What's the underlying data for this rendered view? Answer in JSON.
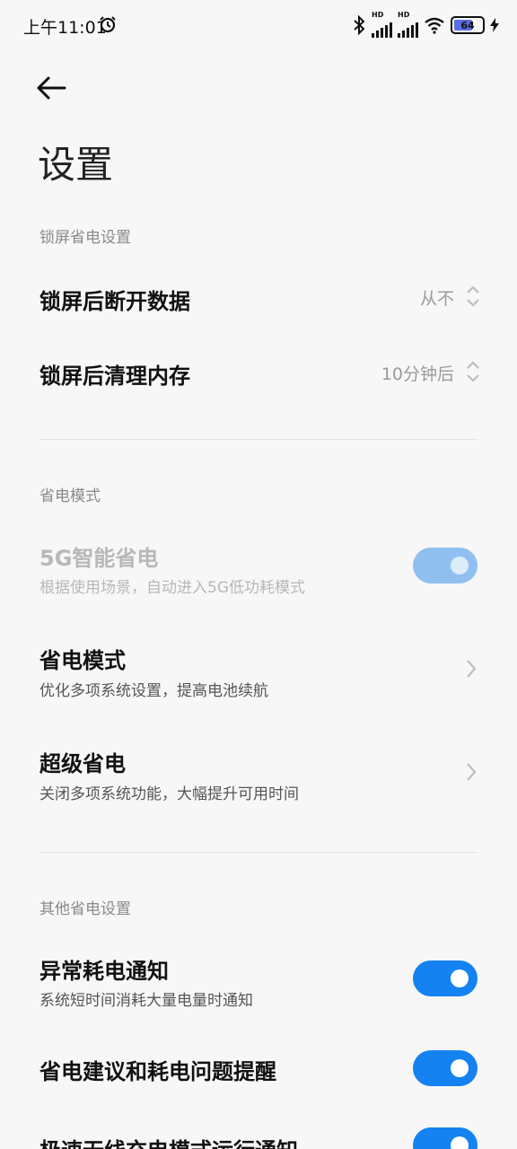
{
  "status": {
    "time": "上午11:01",
    "network_1": "HD",
    "network_2": "HD",
    "battery": "64"
  },
  "header": {
    "title": "设置"
  },
  "sections": {
    "lock": {
      "header": "锁屏省电设置",
      "items": [
        {
          "title": "锁屏后断开数据",
          "value": "从不"
        },
        {
          "title": "锁屏后清理内存",
          "value": "10分钟后"
        }
      ]
    },
    "mode": {
      "header": "省电模式",
      "items": [
        {
          "title": "5G智能省电",
          "subtitle": "根据使用场景，自动进入5G低功耗模式",
          "toggle_on": true,
          "enabled": false
        },
        {
          "title": "省电模式",
          "subtitle": "优化多项系统设置，提高电池续航"
        },
        {
          "title": "超级省电",
          "subtitle": "关闭多项系统功能，大幅提升可用时间"
        }
      ]
    },
    "other": {
      "header": "其他省电设置",
      "items": [
        {
          "title": "异常耗电通知",
          "subtitle": "系统短时间消耗大量电量时通知",
          "toggle_on": true
        },
        {
          "title": "省电建议和耗电问题提醒",
          "toggle_on": true
        },
        {
          "title": "极速无线充电模式运行通知",
          "toggle_on": true
        }
      ]
    }
  },
  "colors": {
    "accent": "#1482f0",
    "accent_disabled": "#8fc0f0",
    "background": "#f7f7f7"
  }
}
